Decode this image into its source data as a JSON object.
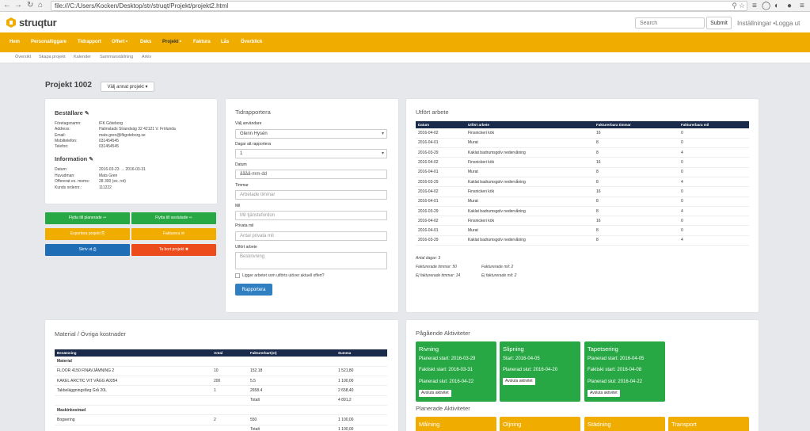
{
  "browser": {
    "url": "file:///C:/Users/Kocken/Desktop/str/struqt/Projekt/projekt2.html"
  },
  "header": {
    "logo": "struqtur",
    "search_placeholder": "Search",
    "submit_label": "Submit",
    "settings": "Inställningar",
    "logout": "•Logga ut"
  },
  "mainnav": {
    "items": [
      "Hem",
      "Personalliggare",
      "Tidrapport",
      "Offert",
      "Deks",
      "Projekt",
      "Faktura",
      "Lås",
      "Överblick"
    ]
  },
  "subnav": {
    "items": [
      "Översikt",
      "Skapa projekt",
      "Kalender",
      "Sammanställning",
      "Arkiv"
    ]
  },
  "page": {
    "title": "Projekt 1002",
    "project_select": "Välj annat projekt ▾"
  },
  "customer": {
    "title": "Beställare",
    "rows": [
      {
        "k": "Företagsnamn:",
        "v": "IFK Göteborg"
      },
      {
        "k": "Address:",
        "v": "Halmstads Strandväg 32 42121 V. Frölunda"
      },
      {
        "k": "Email:",
        "v": "mats.gren@ifkgoteborg.se"
      },
      {
        "k": "Mobiltelefon:",
        "v": "031454545"
      },
      {
        "k": "Telefon:",
        "v": "031454545"
      }
    ]
  },
  "info": {
    "title": "Information",
    "rows": [
      {
        "k": "Datum:",
        "v": "2016-03-23 → 2016-03-31"
      },
      {
        "k": "Huvudman:",
        "v": "Mats Gren"
      },
      {
        "k": "Offererat ex. moms:",
        "v": "28 300 (ex. rot)"
      },
      {
        "k": "Kunds ordernr.:",
        "v": "111222"
      }
    ]
  },
  "actions": {
    "move_planned": "Flytta till planerade ⇦",
    "move_finished": "Flytta till avslutade ⇨",
    "export": "Exportera projekt ⎘",
    "invoice": "Fakturera ✉",
    "print": "Skriv ut ⎙",
    "delete": "Ta bort projekt ✖"
  },
  "timereport": {
    "title": "Tidrapportera",
    "user_label": "Välj användare",
    "user_value": "Glenn Hysén",
    "days_label": "Dagar att rapportera",
    "days_value": "1",
    "date_label": "Datum",
    "date_placeholder": "åååå-mm-dd",
    "hours_label": "Timmar",
    "hours_placeholder": "Arbetade timmar",
    "mil_label": "Mil",
    "mil_placeholder": "Mil tjänstefordon",
    "private_label": "Privata mil",
    "private_placeholder": "Antal privata mil",
    "work_label": "Utfört arbete",
    "work_placeholder": "Beskrivning",
    "checkbox_label": "Ligger arbetet som utförts utöver aktuell offert?",
    "submit": "Rapportera"
  },
  "work": {
    "title": "Utfört arbete",
    "headers": [
      "Datum",
      "Utfört arbete",
      "Fakturerbara timmar",
      "Fakturerbara mil"
    ],
    "rows": [
      [
        "2016-04-02",
        "Finsnickeri kök",
        "16",
        "0"
      ],
      [
        "2016-04-01",
        "Murat",
        "8",
        "0"
      ],
      [
        "2016-03-29",
        "Kaklat badrumsgolv nedervåning",
        "8",
        "4"
      ],
      [
        "2016-04-02",
        "Finsnickeri kök",
        "16",
        "0"
      ],
      [
        "2016-04-01",
        "Murat",
        "8",
        "0"
      ],
      [
        "2016-03-29",
        "Kaklat badrumsgolv nedervåning",
        "8",
        "4"
      ],
      [
        "2016-04-02",
        "Finsnickeri kök",
        "16",
        "0"
      ],
      [
        "2016-04-01",
        "Murat",
        "8",
        "0"
      ],
      [
        "2016-03-29",
        "Kaklat badrumsgolv nedervåning",
        "8",
        "4"
      ],
      [
        "2016-04-02",
        "Finsnickeri kök",
        "16",
        "0"
      ],
      [
        "2016-04-01",
        "Murat",
        "8",
        "0"
      ],
      [
        "2016-03-29",
        "Kaklat badrumsgolv nedervåning",
        "8",
        "4"
      ]
    ],
    "days": "Antal dagar: 3",
    "billed_hours": "Fakturerade timmar: 50",
    "billed_mil": "Fakturerade mil: 2",
    "unbilled_hours": "Ej fakturerade timmar: 14",
    "unbilled_mil": "Ej fakturerade mil: 2"
  },
  "materials": {
    "title": "Material / Övriga kostnader",
    "headers": [
      "Benämning",
      "Antal",
      "Fakturerbart(st)",
      "Summa"
    ],
    "rows": [
      [
        "Material",
        "",
        "",
        ""
      ],
      [
        "FLOOR 4150 FINAVJÄMNING 2",
        "10",
        "152.18",
        "1 521,80"
      ],
      [
        "KAKEL ARCTIC VIT VÄGG A0354",
        "200",
        "5.5",
        "1 100,00"
      ],
      [
        "Takbeläggningsfärg Grå 20L",
        "1",
        "2658.4",
        "2 658,40"
      ],
      [
        "",
        "",
        "Totalt",
        "4 891,2"
      ],
      [
        "Maskinkostnad",
        "",
        "",
        ""
      ],
      [
        "Bogsering",
        "2",
        "550",
        "1 100,00"
      ],
      [
        "",
        "",
        "Totalt",
        "1 100,00"
      ]
    ]
  },
  "ongoing": {
    "title": "Pågående Aktiviteter",
    "finish_label": "Avsluta aktivitet",
    "items": [
      {
        "name": "Rivning",
        "l1": "Planerad start: 2016-03-29",
        "l2": "Faktiskt start: 2016-03-31",
        "l3": "Planerad slut: 2016-04-22"
      },
      {
        "name": "Slipning",
        "l1": "Start: 2016-04-05",
        "l2": "Planerad slut: 2016-04-20",
        "l3": ""
      },
      {
        "name": "Tapetsering",
        "l1": "Planerad start: 2016-04-05",
        "l2": "Faktiskt start: 2016-04-08",
        "l3": "Planerad slut: 2016-04-22"
      }
    ]
  },
  "planned": {
    "title": "Planerade Aktiviteter",
    "items": [
      "Målning",
      "Oljning",
      "Städning",
      "Transport"
    ]
  },
  "colors": {
    "accent": "#f0ad00",
    "green": "#27a844",
    "blue": "#1f6db5",
    "red": "#ec4c1c",
    "navy": "#1a2a4a"
  }
}
